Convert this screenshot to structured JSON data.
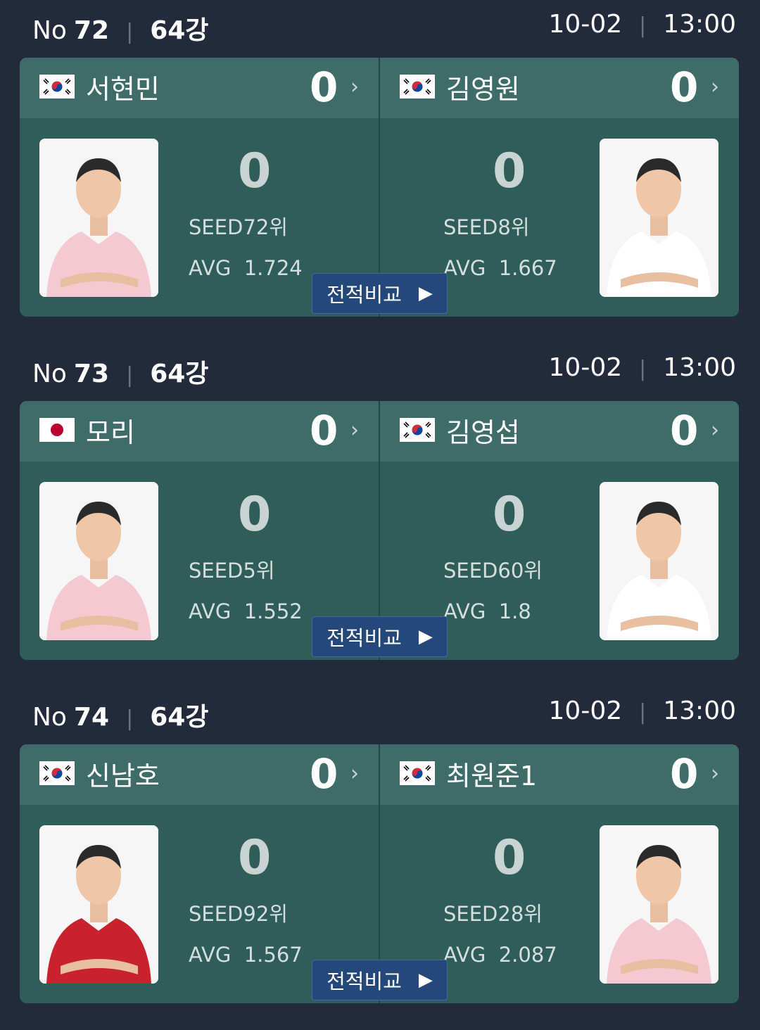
{
  "matches": [
    {
      "no_label": "No",
      "number": "72",
      "round": "64강",
      "date": "10-02",
      "time": "13:00",
      "compare_label": "전적비교",
      "left": {
        "flag": "KOR",
        "name": "서현민",
        "score": "0",
        "game_score": "0",
        "seed": "SEED72위",
        "avg_label": "AVG",
        "avg": "1.724"
      },
      "right": {
        "flag": "KOR",
        "name": "김영원",
        "score": "0",
        "game_score": "0",
        "seed": "SEED8위",
        "avg_label": "AVG",
        "avg": "1.667"
      }
    },
    {
      "no_label": "No",
      "number": "73",
      "round": "64강",
      "date": "10-02",
      "time": "13:00",
      "compare_label": "전적비교",
      "left": {
        "flag": "JPN",
        "name": "모리",
        "score": "0",
        "game_score": "0",
        "seed": "SEED5위",
        "avg_label": "AVG",
        "avg": "1.552"
      },
      "right": {
        "flag": "KOR",
        "name": "김영섭",
        "score": "0",
        "game_score": "0",
        "seed": "SEED60위",
        "avg_label": "AVG",
        "avg": "1.8"
      }
    },
    {
      "no_label": "No",
      "number": "74",
      "round": "64강",
      "date": "10-02",
      "time": "13:00",
      "compare_label": "전적비교",
      "left": {
        "flag": "KOR",
        "name": "신남호",
        "score": "0",
        "game_score": "0",
        "seed": "SEED92위",
        "avg_label": "AVG",
        "avg": "1.567"
      },
      "right": {
        "flag": "KOR",
        "name": "최원준1",
        "score": "0",
        "game_score": "0",
        "seed": "SEED28위",
        "avg_label": "AVG",
        "avg": "2.087"
      }
    }
  ],
  "colors": {
    "background": "#232a3b",
    "card": "#2e5d5a",
    "player_bar": "#3e6d69",
    "button": "#24487a"
  }
}
